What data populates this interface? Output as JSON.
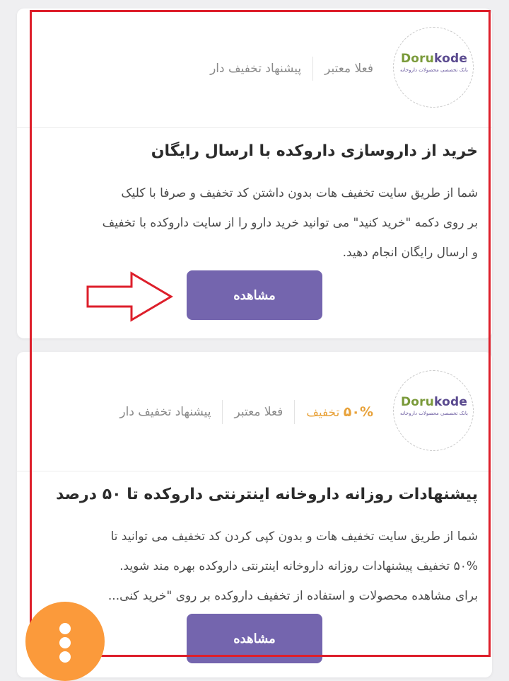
{
  "cards": [
    {
      "logo": {
        "word_green": "Doru",
        "word_purple": "kode",
        "tagline": "بانک تخصصی محصولات داروخانه"
      },
      "meta": {
        "validity": "فعلا معتبر",
        "type": "پیشنهاد تخفیف دار"
      },
      "title": "خرید از داروسازی داروکده با ارسال رایگان",
      "description_lines": [
        "شما از طریق سایت تخفیف هات بدون داشتن کد تخفیف و صرفا با کلیک",
        "بر روی دکمه \"خرید کنید\" می توانید خرید دارو را از سایت داروکده با تخفیف",
        "و ارسال رایگان انجام دهید."
      ],
      "button_label": "مشاهده"
    },
    {
      "logo": {
        "word_green": "Doru",
        "word_purple": "kode",
        "tagline": "بانک تخصصی محصولات داروخانه"
      },
      "meta": {
        "discount_value": "۵۰%",
        "discount_word": "تخفیف",
        "validity": "فعلا معتبر",
        "type": "پیشنهاد تخفیف دار"
      },
      "title": "پیشنهادات روزانه داروخانه اینترنتی داروکده تا ۵۰ درصد",
      "description_lines": [
        "شما از طریق سایت تخفیف هات و بدون کپی کردن کد تخفیف می توانید تا",
        "۵۰% تخفیف پیشنهادات روزانه داروخانه اینترنتی داروکده بهره مند شوید.",
        "برای مشاهده محصولات و استفاده از تخفیف داروکده بر روی \"خرید کنی..."
      ],
      "button_label": "مشاهده"
    }
  ],
  "fab": {
    "icon": "more-vertical-icon"
  },
  "colors": {
    "background": "#efeff1",
    "button": "#7465ae",
    "discount": "#e8a23a",
    "highlight_frame": "#dd1f2b",
    "fab": "#fb9a3b"
  }
}
